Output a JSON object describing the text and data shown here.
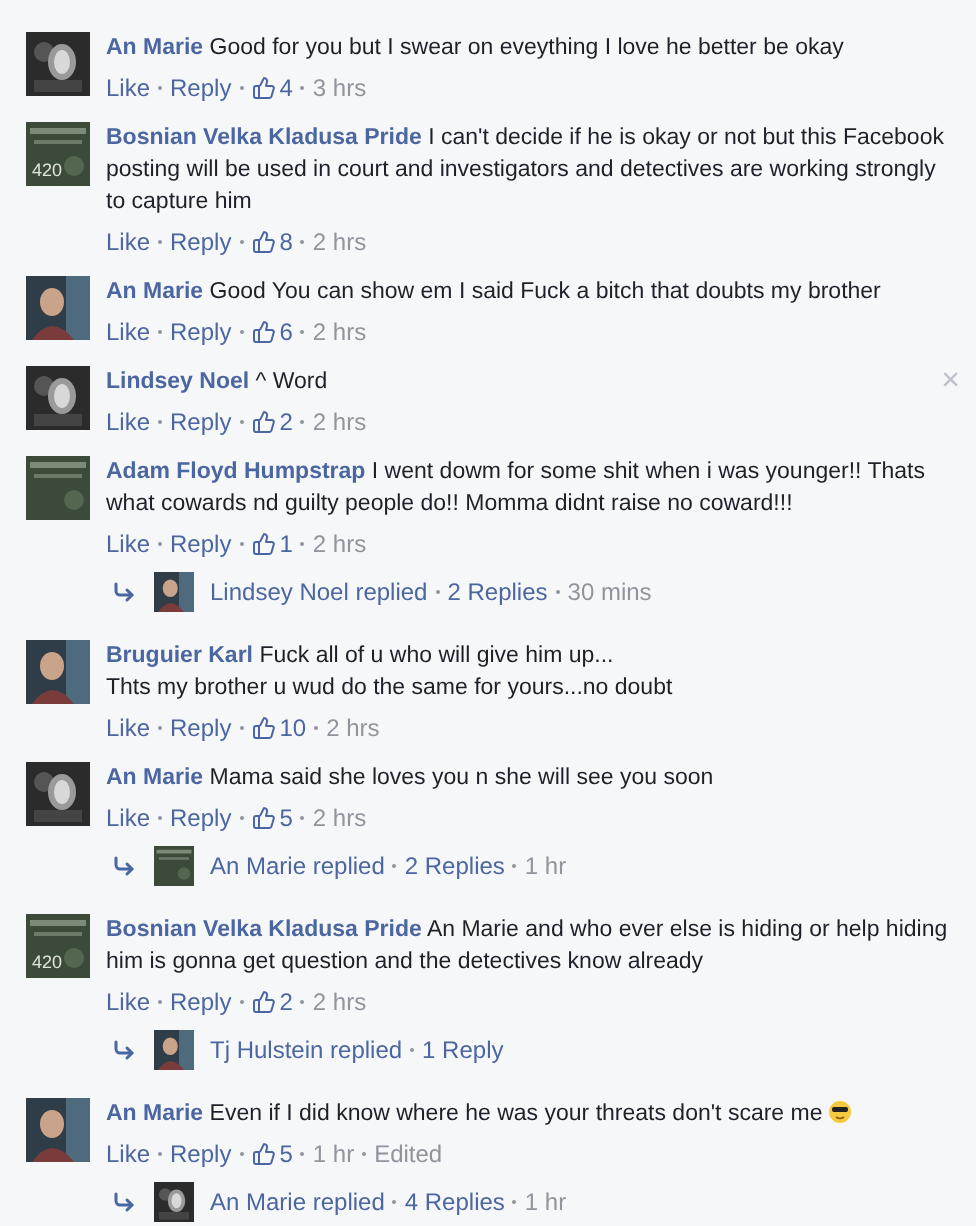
{
  "comments": [
    {
      "author": "An Marie",
      "text": "Good for you but I swear on eveything I love he better be okay",
      "like_label": "Like",
      "reply_label": "Reply",
      "likes": "4",
      "time": "3 hrs"
    },
    {
      "author": "Bosnian Velka Kladusa Pride",
      "text": "I can't decide if he is okay or not but this Facebook posting will be used in court and investigators and detectives are working strongly to capture him",
      "like_label": "Like",
      "reply_label": "Reply",
      "likes": "8",
      "time": "2 hrs",
      "avatar_text": "420"
    },
    {
      "author": "An Marie",
      "text": "Good You can show em I said Fuck a bitch that doubts my brother",
      "like_label": "Like",
      "reply_label": "Reply",
      "likes": "6",
      "time": "2 hrs"
    },
    {
      "author": "Lindsey Noel",
      "text": "^ Word",
      "like_label": "Like",
      "reply_label": "Reply",
      "likes": "2",
      "time": "2 hrs",
      "close": "×"
    },
    {
      "author": "Adam Floyd Humpstrap",
      "text": "I went dowm for some shit when i was younger!! Thats what cowards nd guilty people do!! Momma didnt raise no coward!!!",
      "like_label": "Like",
      "reply_label": "Reply",
      "likes": "1",
      "time": "2 hrs",
      "replies": {
        "text": "Lindsey Noel replied",
        "count": "2 Replies",
        "time": "30 mins"
      }
    },
    {
      "author": "Bruguier Karl",
      "text": "Fuck all of u who will give him up...\nThts my brother u wud do the same for yours...no doubt",
      "like_label": "Like",
      "reply_label": "Reply",
      "likes": "10",
      "time": "2 hrs"
    },
    {
      "author": "An Marie",
      "text": "Mama said she loves you n she will see you soon",
      "like_label": "Like",
      "reply_label": "Reply",
      "likes": "5",
      "time": "2 hrs",
      "replies": {
        "text": "An Marie replied",
        "count": "2 Replies",
        "time": "1 hr"
      }
    },
    {
      "author": "Bosnian Velka Kladusa Pride",
      "text": "An Marie and who ever else is hiding or help hiding him is gonna get question and the detectives know already",
      "like_label": "Like",
      "reply_label": "Reply",
      "likes": "2",
      "time": "2 hrs",
      "avatar_text": "420",
      "replies": {
        "text": "Tj Hulstein replied",
        "count": "1 Reply"
      }
    },
    {
      "author": "An Marie",
      "text": "Even if I did know where he was your threats don't scare me",
      "emoji": true,
      "like_label": "Like",
      "reply_label": "Reply",
      "likes": "5",
      "time": "1 hr",
      "edited": "Edited",
      "replies": {
        "text": "An Marie replied",
        "count": "4 Replies",
        "time": "1 hr"
      }
    }
  ]
}
